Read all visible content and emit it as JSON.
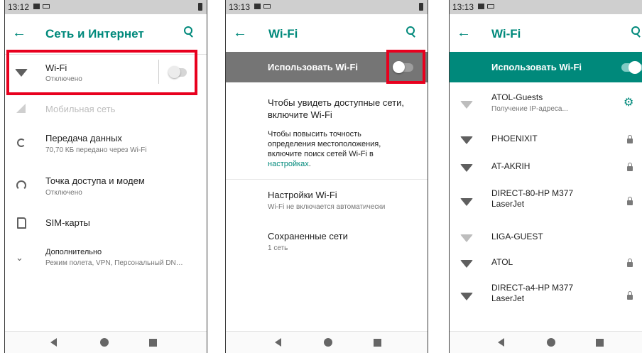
{
  "screens": [
    {
      "status_time": "13:12",
      "title": "Сеть и Интернет",
      "items": [
        {
          "label": "Wi-Fi",
          "sub": "Отключено",
          "icon": "wifi-icon",
          "toggle": "off"
        },
        {
          "label": "Мобильная сеть",
          "sub": "",
          "icon": "signal-icon",
          "disabled": true
        },
        {
          "label": "Передача данных",
          "sub": "70,70 КБ передано через Wi-Fi",
          "icon": "data-usage-icon"
        },
        {
          "label": "Точка доступа и модем",
          "sub": "Отключено",
          "icon": "hotspot-icon"
        },
        {
          "label": "SIM-карты",
          "sub": "",
          "icon": "sim-card-icon"
        },
        {
          "label": "Дополнительно",
          "sub": "Режим полета, VPN, Персональный DN…",
          "icon": "chevron-down-icon"
        }
      ]
    },
    {
      "status_time": "13:13",
      "title": "Wi-Fi",
      "master_label": "Использовать Wi-Fi",
      "master_state": "off",
      "empty_title": "Чтобы увидеть доступные сети, включите Wi-Fi",
      "hint_line1": "Чтобы повысить точность",
      "hint_line2": "определения местоположения,",
      "hint_line3": "включите поиск сетей Wi-Fi в",
      "hint_link": "настройках",
      "hint_end": ".",
      "settings_label": "Настройки Wi-Fi",
      "settings_sub": "Wi-Fi не включается автоматически",
      "saved_label": "Сохраненные сети",
      "saved_sub": "1 сеть"
    },
    {
      "status_time": "13:13",
      "title": "Wi-Fi",
      "master_label": "Использовать Wi-Fi",
      "master_state": "on",
      "networks": [
        {
          "ssid": "ATOL-Guests",
          "status": "Получение IP-адреса...",
          "secured": false,
          "action": "settings-gear"
        },
        {
          "ssid": "PHOENIXIT",
          "status": "",
          "secured": true
        },
        {
          "ssid": "AT-AKRIH",
          "status": "",
          "secured": true
        },
        {
          "ssid": "DIRECT-80-HP M377 LaserJet",
          "line1": "DIRECT-80-HP M377",
          "line2": "LaserJet",
          "status": "",
          "secured": true
        },
        {
          "ssid": "LIGA-GUEST",
          "status": "",
          "secured": false
        },
        {
          "ssid": "ATOL",
          "status": "",
          "secured": true
        },
        {
          "ssid": "DIRECT-a4-HP M377 LaserJet",
          "line1": "DIRECT-a4-HP M377",
          "line2": "LaserJet",
          "status": "",
          "secured": true
        }
      ]
    }
  ],
  "colors": {
    "accent": "#00897b",
    "master_off_bg": "#757575",
    "master_on_bg": "#00897b",
    "highlight": "#e8001e",
    "status_bar": "#cfcfcf"
  }
}
